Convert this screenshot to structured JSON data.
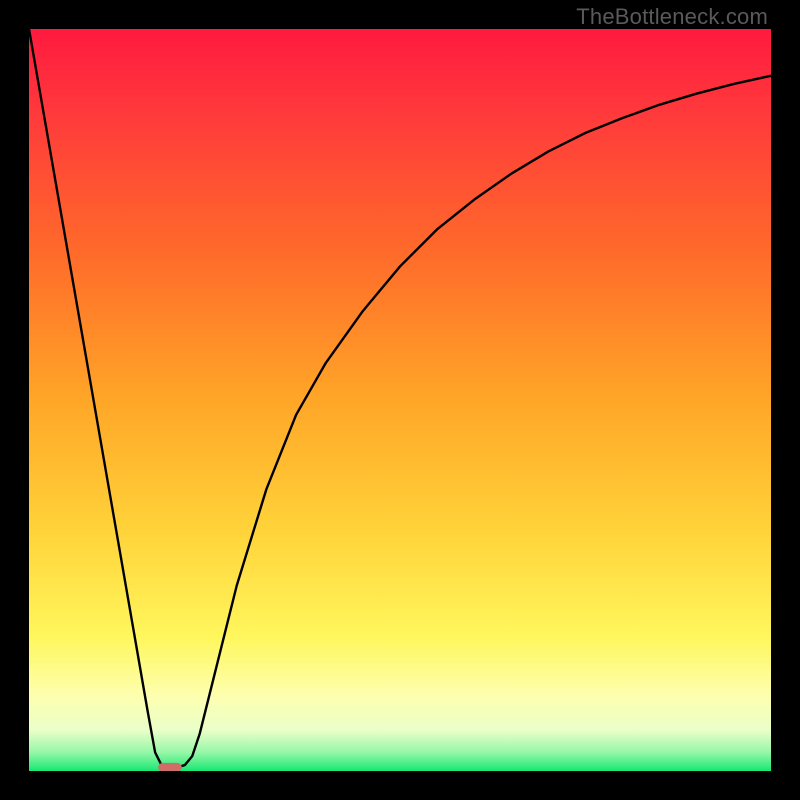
{
  "watermark": "TheBottleneck.com",
  "chart_data": {
    "type": "line",
    "title": "",
    "xlabel": "",
    "ylabel": "",
    "xlim": [
      0,
      100
    ],
    "ylim": [
      0,
      100
    ],
    "grid": false,
    "legend": false,
    "background_gradient_stops": [
      {
        "pct": 0.0,
        "color": "#ff1a3f"
      },
      {
        "pct": 0.12,
        "color": "#ff3b3b"
      },
      {
        "pct": 0.3,
        "color": "#ff6a2a"
      },
      {
        "pct": 0.5,
        "color": "#ffa627"
      },
      {
        "pct": 0.68,
        "color": "#ffd43a"
      },
      {
        "pct": 0.82,
        "color": "#fff75d"
      },
      {
        "pct": 0.9,
        "color": "#fdffb0"
      },
      {
        "pct": 0.945,
        "color": "#eaffc9"
      },
      {
        "pct": 0.975,
        "color": "#96f7a8"
      },
      {
        "pct": 1.0,
        "color": "#17e872"
      }
    ],
    "series": [
      {
        "name": "bottleneck-curve",
        "x": [
          0,
          2,
          4,
          6,
          8,
          10,
          12,
          14,
          16,
          17,
          18,
          19,
          20,
          21,
          22,
          23,
          25,
          28,
          32,
          36,
          40,
          45,
          50,
          55,
          60,
          65,
          70,
          75,
          80,
          85,
          90,
          95,
          100
        ],
        "y": [
          100,
          88.5,
          77,
          65.5,
          54,
          42.5,
          31,
          19.5,
          8,
          2.5,
          0.5,
          0.5,
          0.5,
          0.8,
          2,
          5,
          13,
          25,
          38,
          48,
          55,
          62,
          68,
          73,
          77,
          80.5,
          83.5,
          86,
          88,
          89.8,
          91.3,
          92.6,
          93.7
        ]
      }
    ],
    "marker": {
      "name": "min-marker",
      "x": 19,
      "y": 0.5,
      "width_pct": 3.2,
      "height_pct": 1.2,
      "color": "#cf6d68"
    }
  }
}
